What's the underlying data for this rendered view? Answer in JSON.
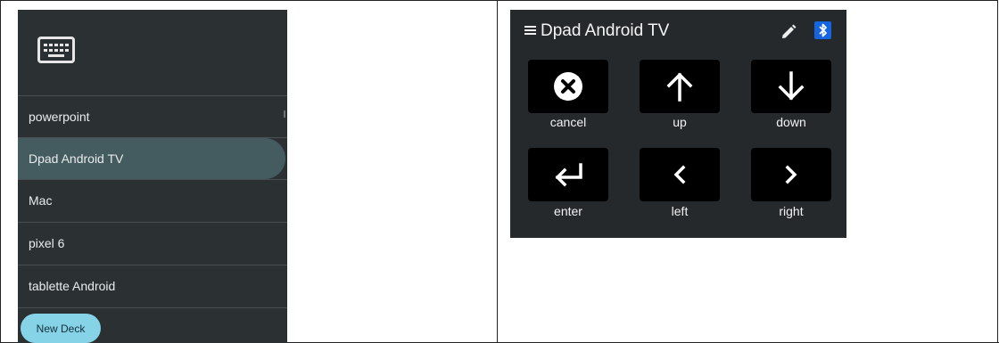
{
  "left_panel": {
    "keyboard_icon": "keyboard-icon",
    "items": [
      {
        "label": "powerpoint",
        "active": false
      },
      {
        "label": "Dpad Android TV",
        "active": true
      },
      {
        "label": "Mac",
        "active": false
      },
      {
        "label": "pixel 6",
        "active": false
      },
      {
        "label": "tablette Android",
        "active": false
      }
    ],
    "new_deck_label": "New Deck",
    "colors": {
      "background": "#2b3033",
      "active": "#445b60",
      "fab": "#86d2e6"
    }
  },
  "right_panel": {
    "title": "Dpad Android TV",
    "menu_icon": "hamburger-menu-icon",
    "edit_icon": "pencil-icon",
    "bluetooth_icon": "bluetooth-icon",
    "buttons": [
      {
        "label": "cancel",
        "icon": "cancel-circle-icon"
      },
      {
        "label": "up",
        "icon": "arrow-up-icon"
      },
      {
        "label": "down",
        "icon": "arrow-down-icon"
      },
      {
        "label": "enter",
        "icon": "enter-return-icon"
      },
      {
        "label": "left",
        "icon": "chevron-left-icon"
      },
      {
        "label": "right",
        "icon": "chevron-right-icon"
      }
    ],
    "colors": {
      "background": "#26292c",
      "button": "#000000",
      "bluetooth": "#1565e0"
    }
  }
}
